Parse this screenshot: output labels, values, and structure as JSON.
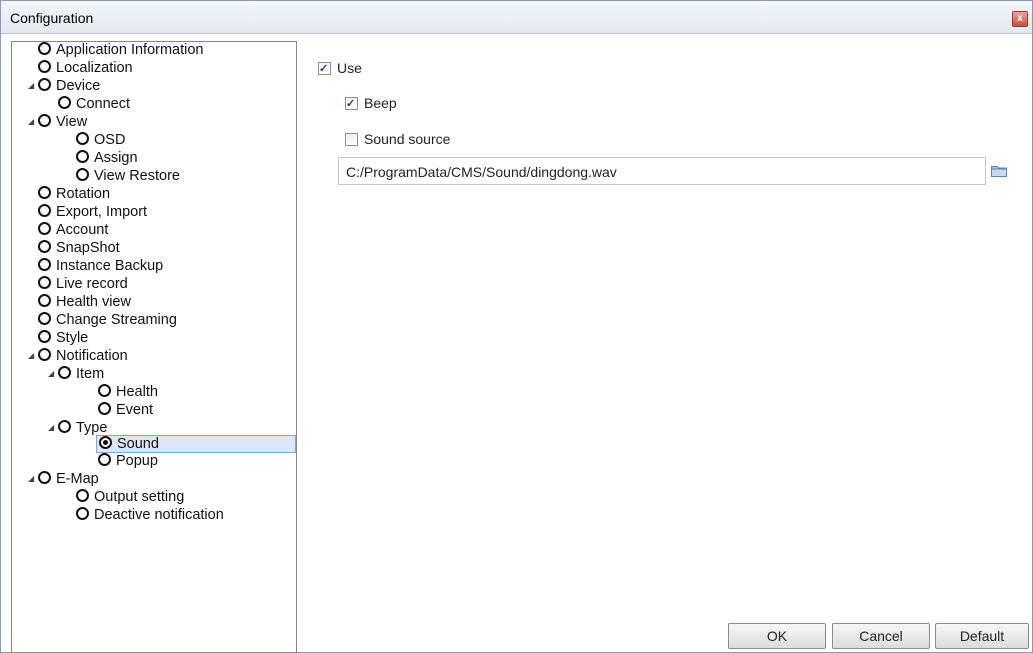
{
  "window": {
    "title": "Configuration",
    "close_label": "x"
  },
  "tree": {
    "items": [
      {
        "label": "Application Information"
      },
      {
        "label": "Localization"
      },
      {
        "label": "Device"
      },
      {
        "label": "Connect"
      },
      {
        "label": "View"
      },
      {
        "label": "OSD"
      },
      {
        "label": "Assign"
      },
      {
        "label": "View Restore"
      },
      {
        "label": "Rotation"
      },
      {
        "label": "Export, Import"
      },
      {
        "label": "Account"
      },
      {
        "label": "SnapShot"
      },
      {
        "label": "Instance Backup"
      },
      {
        "label": "Live record"
      },
      {
        "label": "Health view"
      },
      {
        "label": "Change Streaming"
      },
      {
        "label": "Style"
      },
      {
        "label": "Notification"
      },
      {
        "label": "Item"
      },
      {
        "label": "Health"
      },
      {
        "label": "Event"
      },
      {
        "label": "Type"
      },
      {
        "label": "Sound"
      },
      {
        "label": "Popup"
      },
      {
        "label": "E-Map"
      },
      {
        "label": "Output setting"
      },
      {
        "label": "Deactive notification"
      }
    ],
    "selected": "Sound",
    "expand_glyph": "◢"
  },
  "settings": {
    "use": {
      "label": "Use",
      "checked": true
    },
    "beep": {
      "label": "Beep",
      "checked": true
    },
    "sound_source": {
      "label": "Sound source",
      "checked": false
    },
    "path_value": "C:/ProgramData/CMS/Sound/dingdong.wav"
  },
  "buttons": {
    "ok": "OK",
    "cancel": "Cancel",
    "default": "Default"
  },
  "colors": {
    "selection": "#dce8f7",
    "selection_border": "#7fa6d6",
    "checkmark": "#1f3b73"
  }
}
